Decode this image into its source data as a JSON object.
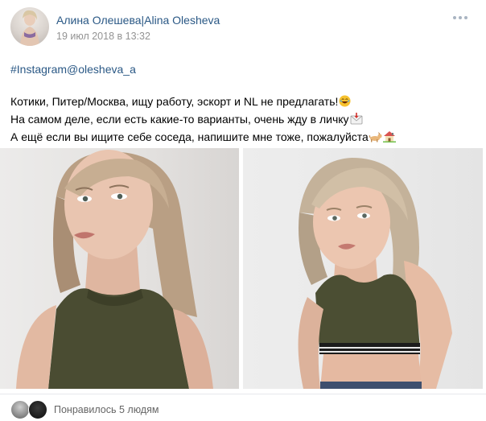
{
  "post": {
    "author": "Алина Олешева|Alina Olesheva",
    "date": "19 июл 2018 в 13:32",
    "hashtag": "#Instagram@olesheva_a",
    "lines": [
      "Котики, Питер/Москва, ищу работу, эскорт и NL не предлагать!",
      "На самом деле, если есть какие-то варианты, очень жду в личку",
      "А ещё если вы ищите себе соседа, напишите мне тоже, пожалуйста"
    ],
    "emojis": [
      "laughing-face-emoji",
      "incoming-envelope-emoji",
      "dog-emoji",
      "house-emoji"
    ],
    "photos": [
      "photo-portrait-1",
      "photo-portrait-2"
    ]
  },
  "footer": {
    "likes_text": "Понравилось 5 людям"
  },
  "colors": {
    "link": "#2a5885",
    "meta": "#939393",
    "divider": "#e7e8ec"
  }
}
